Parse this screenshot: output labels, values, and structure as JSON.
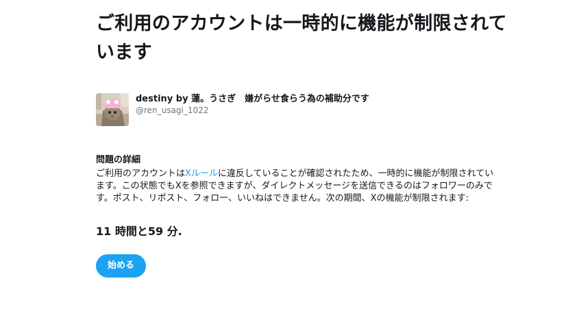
{
  "page": {
    "title": "ご利用のアカウントは一時的に機能が制限されています"
  },
  "account": {
    "display_name": "destiny by 蓮。うさぎ　嫌がらせ食らう為の補助分です",
    "screen_name": "@ren_usagi_1022",
    "avatar_icon": "cat-avatar-icon"
  },
  "details": {
    "heading": "問題の詳細",
    "body_before_link": "ご利用のアカウントは",
    "link_text": "Xルール",
    "body_after_link": "に違反していることが確認されたため、一時的に機能が制限されています。この状態でもXを参照できますが、ダイレクトメッセージを送信できるのはフォロワーのみです。ポスト、リポスト、フォロー、いいねはできません。次の期間、Xの機能が制限されます:"
  },
  "countdown": {
    "text": "11 時間と59 分."
  },
  "actions": {
    "start_label": "始める"
  },
  "colors": {
    "accent": "#1da1f2",
    "text": "#14171a",
    "muted": "#657786"
  }
}
